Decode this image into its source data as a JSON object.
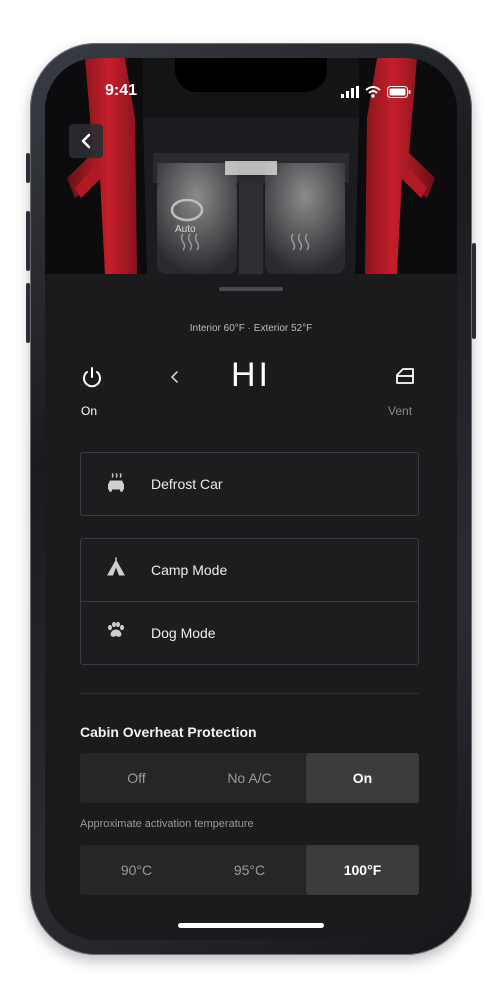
{
  "status_bar": {
    "time": "9:41"
  },
  "hero": {
    "auto_label": "Auto"
  },
  "climate": {
    "temps_text": "Interior 60°F · Exterior 52°F",
    "power_label": "On",
    "temperature": "HI",
    "vent_label": "Vent"
  },
  "actions": {
    "defrost_label": "Defrost Car",
    "camp_label": "Camp Mode",
    "dog_label": "Dog Mode"
  },
  "overheat": {
    "title": "Cabin Overheat Protection",
    "options": [
      "Off",
      "No A/C",
      "On"
    ],
    "selected": "On",
    "activation_label": "Approximate activation temperature",
    "temp_options": [
      "90°C",
      "95°C",
      "100°F"
    ],
    "temp_selected": "100°F"
  },
  "colors": {
    "background": "#1b1b1d",
    "accent_red": "#c41f2b",
    "text": "#ffffff"
  }
}
